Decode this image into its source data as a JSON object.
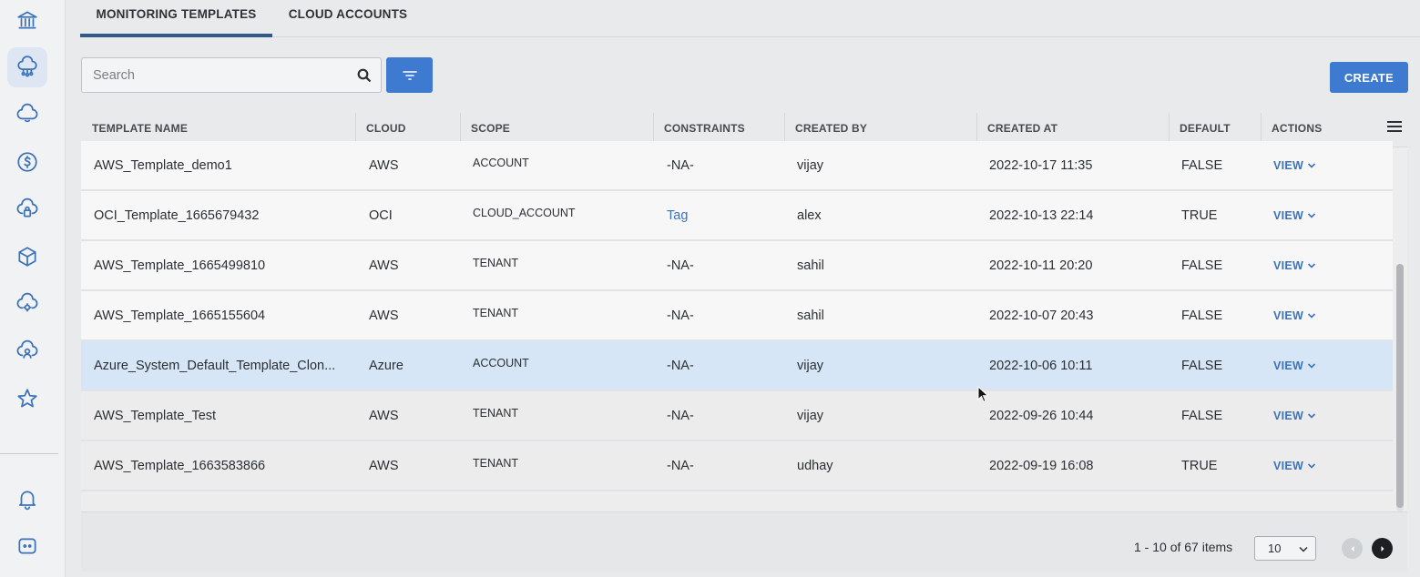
{
  "tabs": [
    {
      "label": "MONITORING TEMPLATES",
      "active": true
    },
    {
      "label": "CLOUD ACCOUNTS",
      "active": false
    }
  ],
  "sidebar": {
    "items": [
      {
        "icon": "bank-icon"
      },
      {
        "icon": "cloud-network-icon",
        "active": true
      },
      {
        "icon": "cloud-refresh-icon"
      },
      {
        "icon": "dollar-icon"
      },
      {
        "icon": "cloud-lock-icon"
      },
      {
        "icon": "cube-icon"
      },
      {
        "icon": "cloud-gear-icon"
      },
      {
        "icon": "cloud-user-icon"
      },
      {
        "icon": "star-icon"
      },
      {
        "icon": "bell-icon"
      },
      {
        "icon": "chat-icon"
      }
    ]
  },
  "search": {
    "placeholder": "Search",
    "value": ""
  },
  "toolbar": {
    "create_label": "CREATE"
  },
  "table": {
    "columns": [
      "TEMPLATE NAME",
      "CLOUD",
      "SCOPE",
      "CONSTRAINTS",
      "CREATED BY",
      "CREATED AT",
      "DEFAULT",
      "ACTIONS"
    ],
    "rows": [
      {
        "name": "AWS_Template_demo1",
        "cloud": "AWS",
        "scope": "ACCOUNT",
        "constraints": "-NA-",
        "created_by": "vijay",
        "created_at": "2022-10-17 11:35",
        "default": "FALSE",
        "action": "VIEW"
      },
      {
        "name": "OCI_Template_1665679432",
        "cloud": "OCI",
        "scope": "CLOUD_ACCOUNT",
        "constraints": "Tag",
        "created_by": "alex",
        "created_at": "2022-10-13 22:14",
        "default": "TRUE",
        "action": "VIEW"
      },
      {
        "name": "AWS_Template_1665499810",
        "cloud": "AWS",
        "scope": "TENANT",
        "constraints": "-NA-",
        "created_by": "sahil",
        "created_at": "2022-10-11 20:20",
        "default": "FALSE",
        "action": "VIEW"
      },
      {
        "name": "AWS_Template_1665155604",
        "cloud": "AWS",
        "scope": "TENANT",
        "constraints": "-NA-",
        "created_by": "sahil",
        "created_at": "2022-10-07 20:43",
        "default": "FALSE",
        "action": "VIEW"
      },
      {
        "name": "Azure_System_Default_Template_Clon...",
        "cloud": "Azure",
        "scope": "ACCOUNT",
        "constraints": "-NA-",
        "created_by": "vijay",
        "created_at": "2022-10-06 10:11",
        "default": "FALSE",
        "action": "VIEW"
      },
      {
        "name": "AWS_Template_Test",
        "cloud": "AWS",
        "scope": "TENANT",
        "constraints": "-NA-",
        "created_by": "vijay",
        "created_at": "2022-09-26 10:44",
        "default": "FALSE",
        "action": "VIEW"
      },
      {
        "name": "AWS_Template_1663583866",
        "cloud": "AWS",
        "scope": "TENANT",
        "constraints": "-NA-",
        "created_by": "udhay",
        "created_at": "2022-09-19 16:08",
        "default": "TRUE",
        "action": "VIEW"
      }
    ],
    "selected_row": 4
  },
  "pagination": {
    "summary": "1 - 10 of 67 items",
    "page_size": "10"
  },
  "colors": {
    "accent": "#3e7bd0",
    "tab_underline": "#2f5a8a",
    "link": "#3b72b8",
    "selected_row": "#d6e6f6"
  }
}
